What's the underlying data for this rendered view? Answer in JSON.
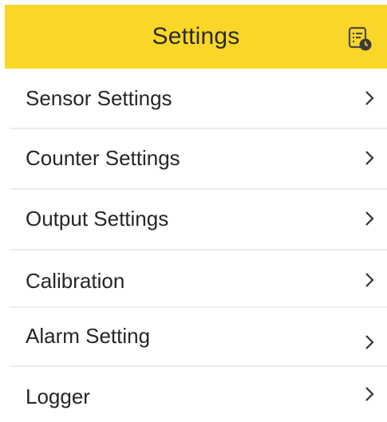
{
  "header": {
    "title": "Settings",
    "icon": "calendar-clock-icon",
    "background_color": "#fad628"
  },
  "menu": {
    "items": [
      {
        "label": "Sensor Settings",
        "icon": "chevron-right-icon"
      },
      {
        "label": "Counter Settings",
        "icon": "chevron-right-icon"
      },
      {
        "label": "Output Settings",
        "icon": "chevron-right-icon"
      },
      {
        "label": "Calibration",
        "icon": "chevron-right-icon"
      },
      {
        "label": "Alarm Setting",
        "icon": "chevron-right-icon"
      },
      {
        "label": "Logger",
        "icon": "chevron-right-icon"
      }
    ]
  }
}
